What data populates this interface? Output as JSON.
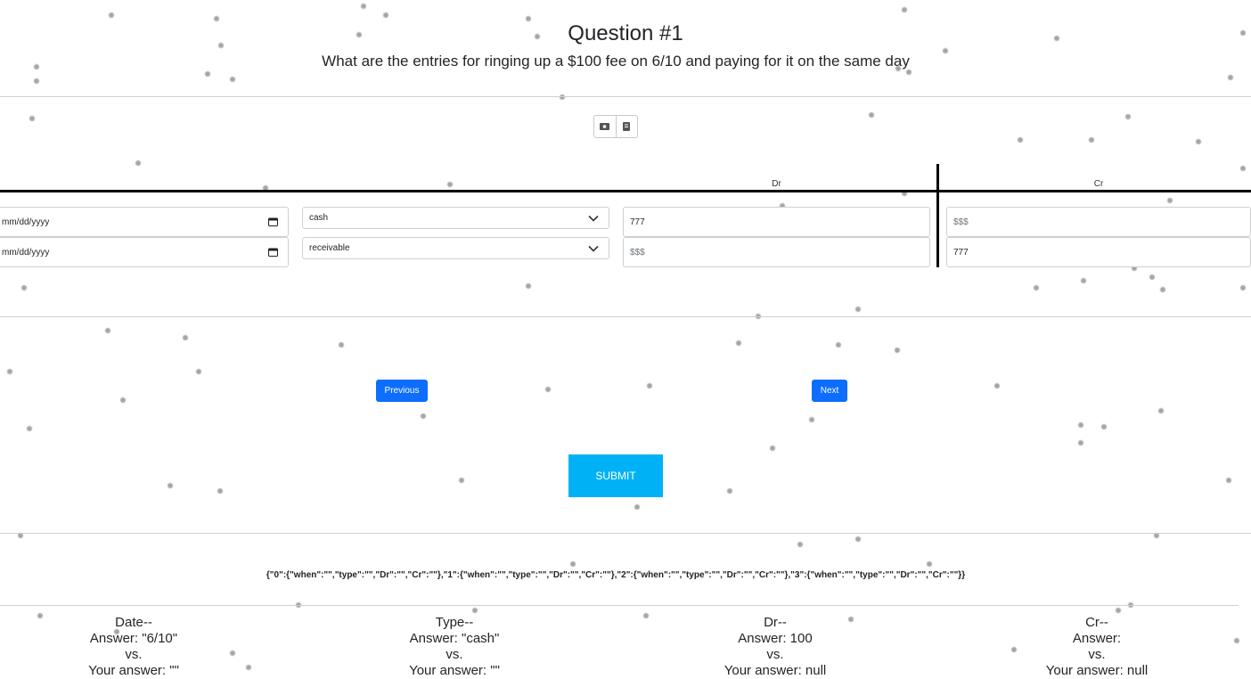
{
  "question": {
    "title": "Question #1",
    "text": "What are the entries for ringing up a $100 fee on 6/10 and paying for it on the same day"
  },
  "toolbar": {
    "icons": [
      "money-icon",
      "receipt-icon"
    ]
  },
  "table": {
    "headers": {
      "dr": "Dr",
      "cr": "Cr"
    },
    "rows": [
      {
        "date_placeholder": "mm/dd/yyyy",
        "type": "cash",
        "dr": "777",
        "cr_placeholder": "$$$"
      },
      {
        "date_placeholder": "mm/dd/yyyy",
        "type": "receivable",
        "dr_placeholder": "$$$",
        "cr": "777"
      }
    ]
  },
  "nav": {
    "previous": "Previous",
    "next": "Next",
    "submit": "SUBMIT"
  },
  "debug_json": "{\"0\":{\"when\":\"\",\"type\":\"\",\"Dr\":\"\",\"Cr\":\"\"},\"1\":{\"when\":\"\",\"type\":\"\",\"Dr\":\"\",\"Cr\":\"\"},\"2\":{\"when\":\"\",\"type\":\"\",\"Dr\":\"\",\"Cr\":\"\"},\"3\":{\"when\":\"\",\"type\":\"\",\"Dr\":\"\",\"Cr\":\"\"}}",
  "results": {
    "date": {
      "heading": "Date--",
      "answer": "Answer: \"6/10\"",
      "vs": "vs.",
      "yours": "Your answer: \"\""
    },
    "type": {
      "heading": "Type--",
      "answer": "Answer: \"cash\"",
      "vs": "vs.",
      "yours": "Your answer: \"\""
    },
    "dr": {
      "heading": "Dr--",
      "answer": "Answer: 100",
      "vs": "vs.",
      "yours": "Your answer: null"
    },
    "cr": {
      "heading": "Cr--",
      "answer": "Answer:",
      "vs": "vs.",
      "yours": "Your answer: null"
    }
  },
  "colors": {
    "primary": "#0d6efd",
    "submit": "#00b2f5"
  }
}
